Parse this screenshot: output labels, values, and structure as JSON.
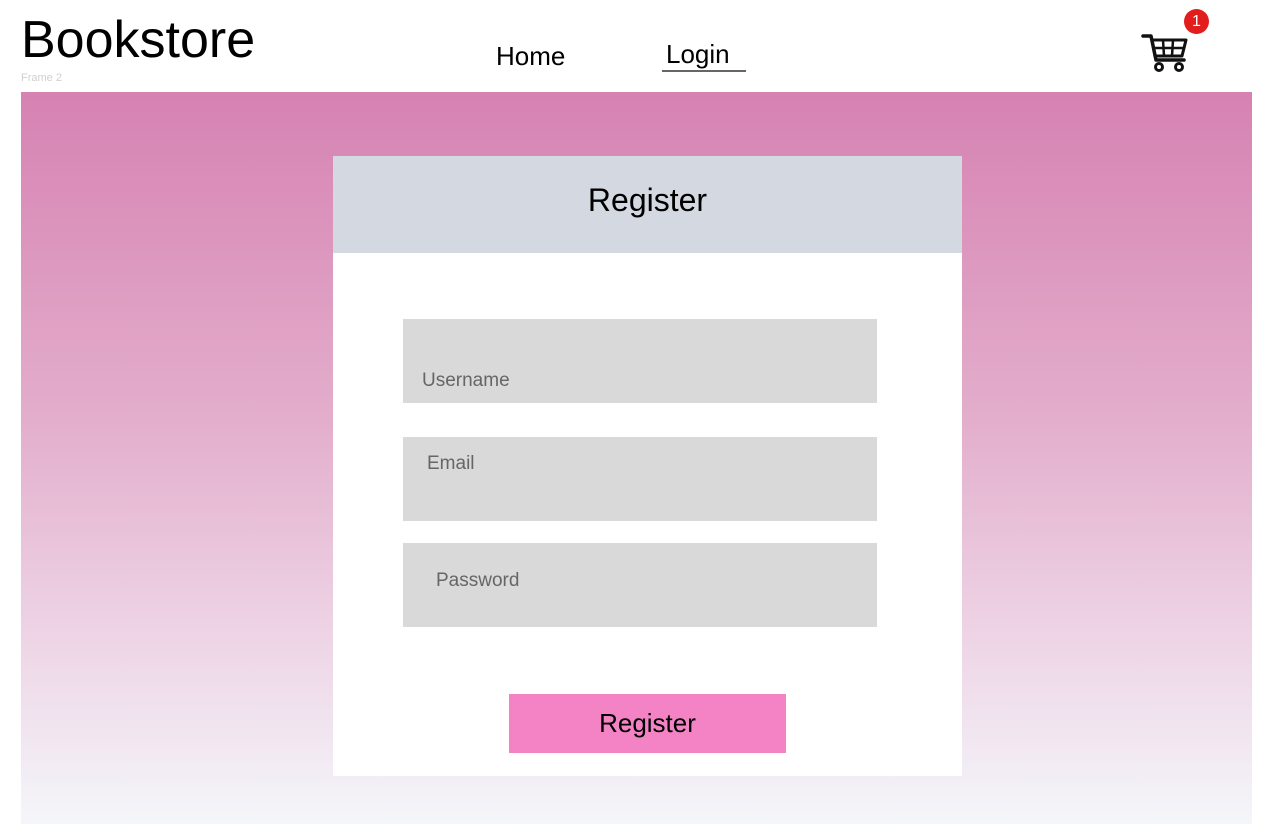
{
  "header": {
    "brand": "Bookstore",
    "frame_label": "Frame 2",
    "nav": {
      "home": "Home",
      "login": "Login"
    },
    "cart": {
      "icon": "shopping-cart-icon",
      "count": "1"
    }
  },
  "form": {
    "title": "Register",
    "username_placeholder": "Username",
    "email_placeholder": "Email",
    "password_placeholder": "Password",
    "submit_label": "Register"
  },
  "colors": {
    "accent_button": "#f483c5",
    "header_band": "#d4d9e1",
    "field_bg": "#d9d9d9",
    "badge": "#e21d1d",
    "gradient_top": "#d682b2",
    "gradient_bottom": "#f4f6fa"
  }
}
